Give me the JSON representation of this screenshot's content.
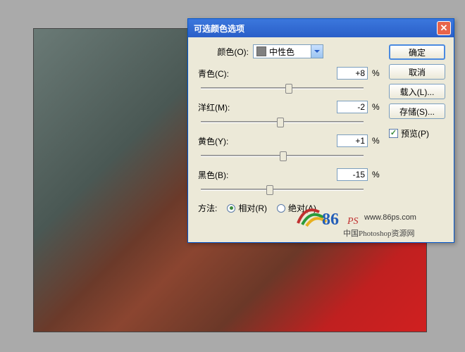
{
  "dialog": {
    "title": "可选颜色选项",
    "color_label": "颜色(O):",
    "color_selected": "中性色",
    "sliders": {
      "cyan": {
        "label": "青色(C):",
        "value": "+8",
        "unit": "%",
        "pos": 54
      },
      "magenta": {
        "label": "洋红(M):",
        "value": "-2",
        "unit": "%",
        "pos": 49
      },
      "yellow": {
        "label": "黄色(Y):",
        "value": "+1",
        "unit": "%",
        "pos": 50.5
      },
      "black": {
        "label": "黑色(B):",
        "value": "-15",
        "unit": "%",
        "pos": 42.5
      }
    },
    "method": {
      "label": "方法:",
      "relative": "相对(R)",
      "absolute": "绝对(A)",
      "selected": "relative"
    },
    "buttons": {
      "ok": "确定",
      "cancel": "取消",
      "load": "载入(L)...",
      "save": "存储(S)..."
    },
    "preview": "预览(P)"
  },
  "watermark": {
    "logo1": "86",
    "logo2": "PS",
    "url": "www.86ps.com",
    "sub": "中国Photoshop资源网"
  }
}
